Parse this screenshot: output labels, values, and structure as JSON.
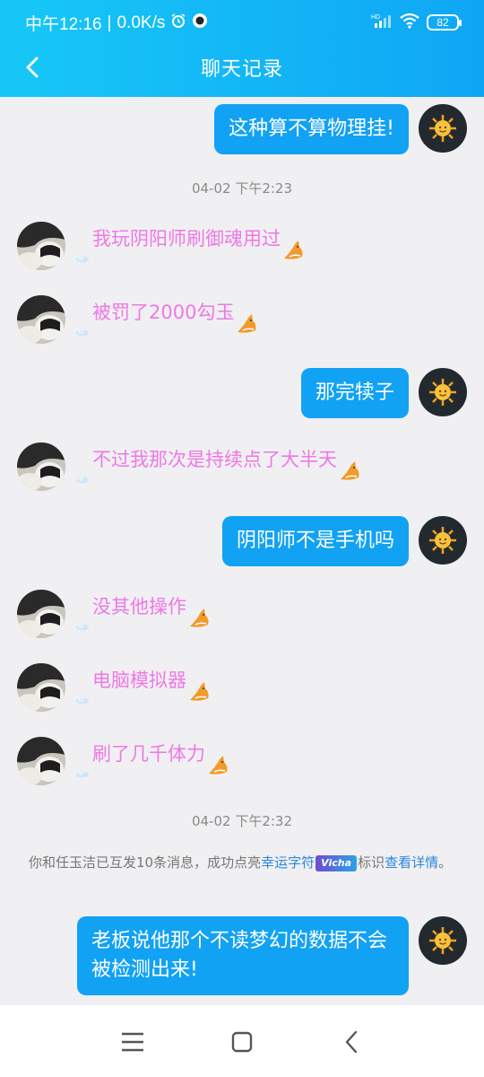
{
  "status_bar": {
    "time": "中午12:16",
    "speed": "0.0K/s",
    "battery": "82"
  },
  "header": {
    "title": "聊天记录"
  },
  "messages": [
    {
      "from": "me",
      "text": "这种算不算物理挂!"
    },
    {
      "type": "time",
      "text": "04-02 下午2:23"
    },
    {
      "from": "other",
      "text": "我玩阴阳师刷御魂用过"
    },
    {
      "from": "other",
      "text": "被罚了2000勾玉"
    },
    {
      "from": "me",
      "text": "那完犊子"
    },
    {
      "from": "other",
      "text": "不过我那次是持续点了大半天"
    },
    {
      "from": "me",
      "text": "阴阳师不是手机吗"
    },
    {
      "from": "other",
      "text": "没其他操作"
    },
    {
      "from": "other",
      "text": "电脑模拟器"
    },
    {
      "from": "other",
      "text": "刷了几千体力"
    },
    {
      "type": "time",
      "text": "04-02 下午2:32"
    },
    {
      "from": "me",
      "text": "老板说他那个不读梦幻的数据不会被检测出来!"
    }
  ],
  "system_notice": {
    "prefix": "你和任玉洁已互发10条消息，成功点亮",
    "highlight": "幸运字符",
    "badge_text": "Vicha",
    "middle": "标识",
    "link": "查看详情",
    "suffix": "。"
  },
  "colors": {
    "header_gradient_start": "#17c8f7",
    "header_gradient_end": "#0fa6f5",
    "my_bubble": "#12a2f4",
    "other_text": "#ee78e6",
    "background": "#f0f0f2"
  }
}
